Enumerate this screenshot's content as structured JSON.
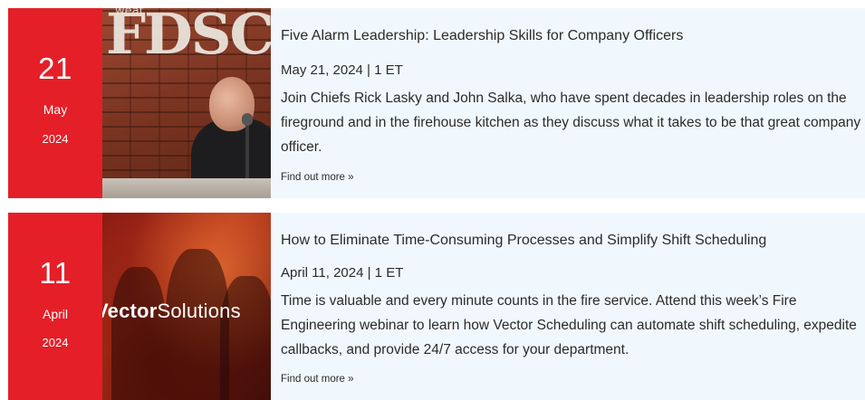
{
  "events": [
    {
      "day": "21",
      "month": "May",
      "year": "2024",
      "thumbnail_sign": "FDSC",
      "thumbnail_sign_small": "weat",
      "title": "Five Alarm Leadership: Leadership Skills for Company Officers",
      "meta": "May 21, 2024 | 1 ET",
      "description": "Join Chiefs Rick Lasky and John Salka, who have spent decades in leadership roles on the fireground and in the firehouse kitchen as they discuss what it takes to be that great company officer.",
      "link": "Find out more »"
    },
    {
      "day": "11",
      "month": "April",
      "year": "2024",
      "thumbnail_logo_bold": "Vector",
      "thumbnail_logo_light": "Solutions",
      "title": "How to Eliminate Time-Consuming Processes and Simplify Shift Scheduling",
      "meta": "April 11, 2024 | 1 ET",
      "description": "Time is valuable and every minute counts in the fire service. Attend this week’s Fire Engineering webinar to learn how Vector Scheduling can automate shift scheduling, expedite callbacks, and provide 24/7 access for your department.",
      "link": "Find out more »"
    }
  ],
  "colors": {
    "date_block": "#e41f28",
    "card_background": "#f1f8fd",
    "text": "#2b2b2b"
  }
}
